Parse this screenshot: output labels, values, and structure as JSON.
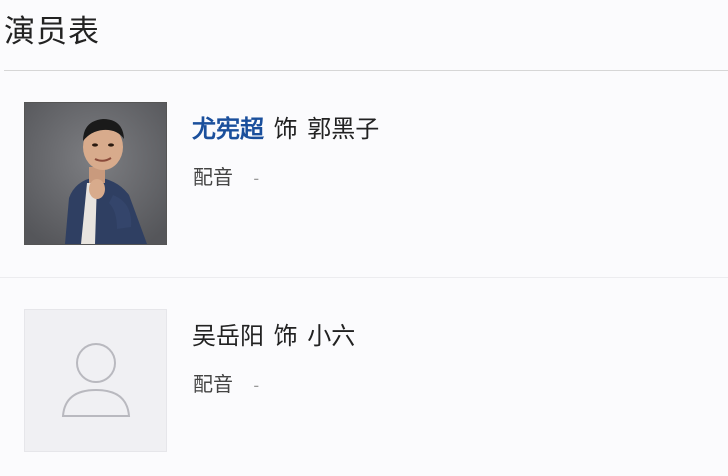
{
  "section": {
    "title": "演员表"
  },
  "cast": [
    {
      "actor": "尤宪超",
      "as_word": "饰",
      "role": "郭黑子",
      "dub_label": "配音",
      "dub_value": "-",
      "photo": "actor-photo",
      "actor_is_link": true
    },
    {
      "actor": "吴岳阳",
      "as_word": "饰",
      "role": "小六",
      "dub_label": "配音",
      "dub_value": "-",
      "photo": "avatar-placeholder-icon",
      "actor_is_link": false
    }
  ],
  "colors": {
    "link": "#1a4f9c",
    "text": "#222222",
    "muted": "#999999",
    "divider": "#d6d6d6"
  }
}
